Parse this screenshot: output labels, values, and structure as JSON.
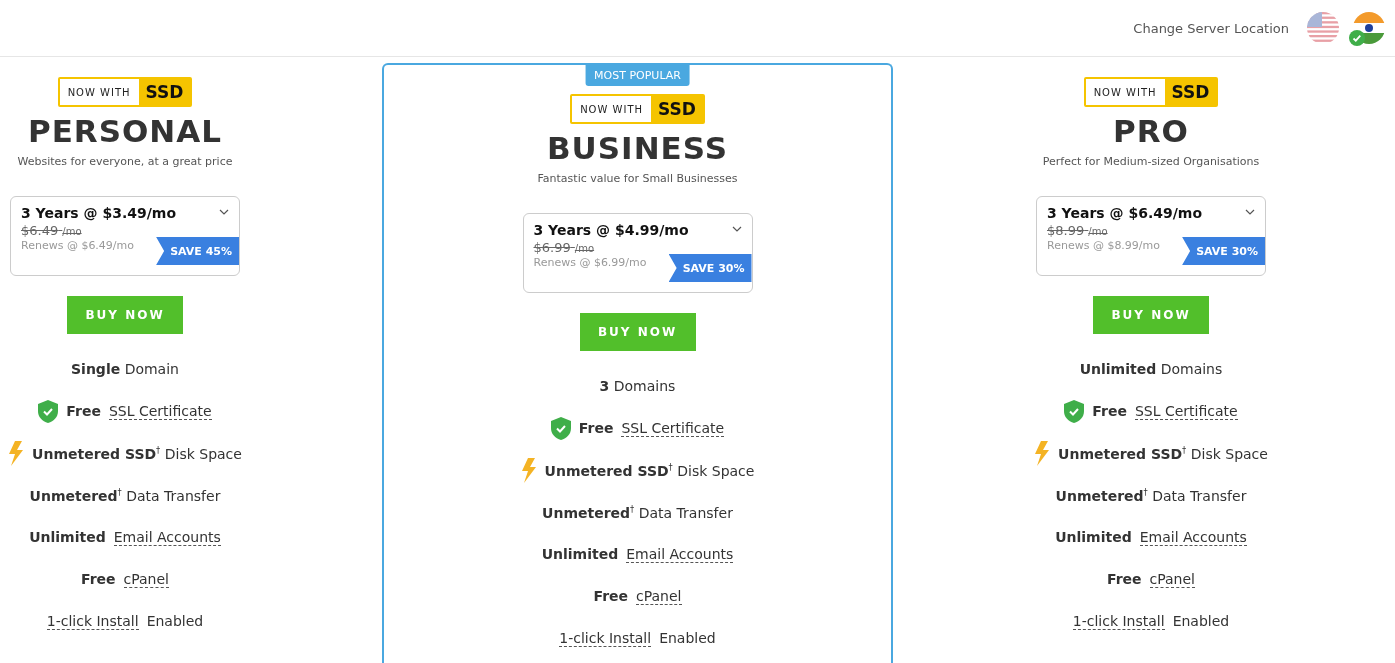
{
  "header": {
    "label": "Change Server Location",
    "locations": [
      {
        "kind": "us",
        "selected": false
      },
      {
        "kind": "india",
        "selected": true
      }
    ]
  },
  "plans": [
    {
      "featured": false,
      "badge_lead": "NOW WITH",
      "badge_strong": "SSD",
      "name": "PERSONAL",
      "tagline": "Websites for everyone, at a great price",
      "term": "3 Years @ $3.49/mo",
      "old_price": "$6.49",
      "old_unit": "/mo",
      "renews": "Renews @ $6.49/mo",
      "save": "SAVE 45%",
      "buy": "BUY NOW",
      "features": [
        {
          "kind": "plain",
          "text": "**Single** Domain"
        },
        {
          "kind": "shield",
          "lead": "Free",
          "term": "SSL Certificate"
        },
        {
          "kind": "bolt",
          "text": "**Unmetered SSD**$^{†}$ Disk Space"
        },
        {
          "kind": "plain",
          "text": "**Unmetered**$^{†}$ Data Transfer"
        },
        {
          "kind": "plain",
          "lead": "Unlimited",
          "term": "Email Accounts"
        },
        {
          "kind": "plain",
          "lead": "Free",
          "term": "cPanel"
        },
        {
          "kind": "plain",
          "term": "1-click Install",
          "tail": "Enabled"
        }
      ]
    },
    {
      "featured": true,
      "ribbon": "MOST POPULAR",
      "badge_lead": "NOW WITH",
      "badge_strong": "SSD",
      "name": "BUSINESS",
      "tagline": "Fantastic value for Small Businesses",
      "term": "3 Years @ $4.99/mo",
      "old_price": "$6.99",
      "old_unit": "/mo",
      "renews": "Renews @ $6.99/mo",
      "save": "SAVE 30%",
      "buy": "BUY NOW",
      "features": [
        {
          "kind": "plain",
          "text": "**3** Domains"
        },
        {
          "kind": "shield",
          "lead": "Free",
          "term": "SSL Certificate"
        },
        {
          "kind": "bolt",
          "text": "**Unmetered SSD**$^{†}$ Disk Space"
        },
        {
          "kind": "plain",
          "text": "**Unmetered**$^{†}$ Data Transfer"
        },
        {
          "kind": "plain",
          "lead": "Unlimited",
          "term": "Email Accounts"
        },
        {
          "kind": "plain",
          "lead": "Free",
          "term": "cPanel"
        },
        {
          "kind": "plain",
          "term": "1-click Install",
          "tail": "Enabled"
        }
      ]
    },
    {
      "featured": false,
      "badge_lead": "NOW WITH",
      "badge_strong": "SSD",
      "name": "PRO",
      "tagline": "Perfect for Medium-sized Organisations",
      "term": "3 Years @ $6.49/mo",
      "old_price": "$8.99",
      "old_unit": "/mo",
      "renews": "Renews @ $8.99/mo",
      "save": "SAVE 30%",
      "buy": "BUY NOW",
      "features": [
        {
          "kind": "plain",
          "text": "**Unlimited** Domains"
        },
        {
          "kind": "shield",
          "lead": "Free",
          "term": "SSL Certificate"
        },
        {
          "kind": "bolt",
          "text": "**Unmetered SSD**$^{†}$ Disk Space"
        },
        {
          "kind": "plain",
          "text": "**Unmetered**$^{†}$ Data Transfer"
        },
        {
          "kind": "plain",
          "lead": "Unlimited",
          "term": "Email Accounts"
        },
        {
          "kind": "plain",
          "lead": "Free",
          "term": "cPanel"
        },
        {
          "kind": "plain",
          "term": "1-click Install",
          "tail": "Enabled"
        }
      ]
    }
  ]
}
